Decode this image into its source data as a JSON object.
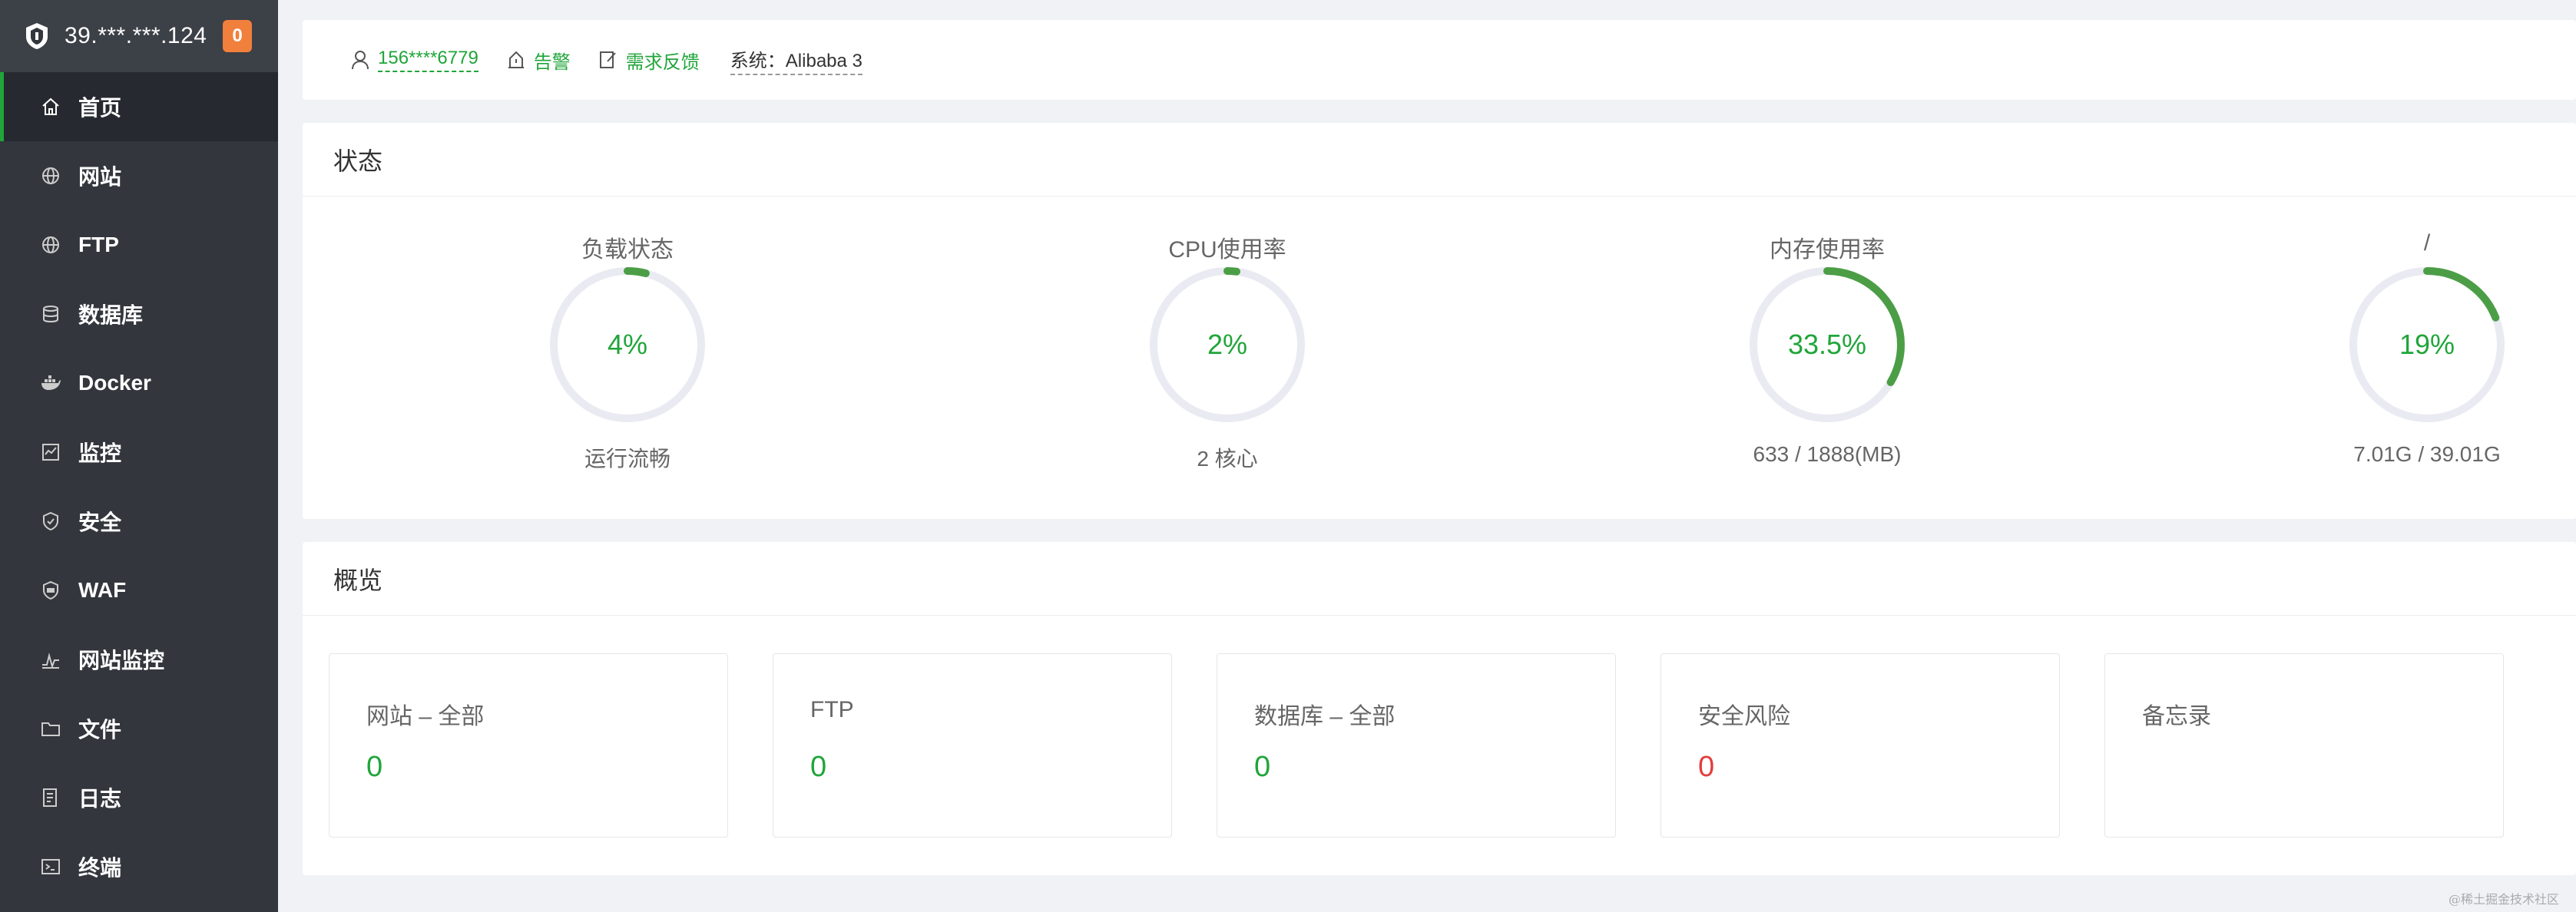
{
  "sidebar": {
    "host": "39.***.***.124",
    "badge": "0",
    "items": [
      {
        "label": "首页"
      },
      {
        "label": "网站"
      },
      {
        "label": "FTP"
      },
      {
        "label": "数据库"
      },
      {
        "label": "Docker"
      },
      {
        "label": "监控"
      },
      {
        "label": "安全"
      },
      {
        "label": "WAF"
      },
      {
        "label": "网站监控"
      },
      {
        "label": "文件"
      },
      {
        "label": "日志"
      },
      {
        "label": "终端"
      }
    ]
  },
  "topbar": {
    "user": "156****6779",
    "alert": "告警",
    "feedback": "需求反馈",
    "system": "系统：Alibaba 3"
  },
  "status": {
    "title": "状态",
    "gauges": [
      {
        "title": "负载状态",
        "value": "4%",
        "percent": 4,
        "sub": "运行流畅"
      },
      {
        "title": "CPU使用率",
        "value": "2%",
        "percent": 2,
        "sub": "2 核心"
      },
      {
        "title": "内存使用率",
        "value": "33.5%",
        "percent": 33.5,
        "sub": "633 / 1888(MB)"
      },
      {
        "title": "/",
        "value": "19%",
        "percent": 19,
        "sub": "7.01G / 39.01G"
      }
    ]
  },
  "overview": {
    "title": "概览",
    "items": [
      {
        "label": "网站 – 全部",
        "value": "0"
      },
      {
        "label": "FTP",
        "value": "0"
      },
      {
        "label": "数据库 – 全部",
        "value": "0"
      },
      {
        "label": "安全风险",
        "value": "0"
      },
      {
        "label": "备忘录",
        "value": ""
      }
    ]
  },
  "colors": {
    "accent": "#20a53a",
    "gauge_track": "#eaeaf2",
    "gauge_fill": "#4c9e46",
    "danger": "#e53c3c"
  },
  "watermark": "@稀土掘金技术社区"
}
